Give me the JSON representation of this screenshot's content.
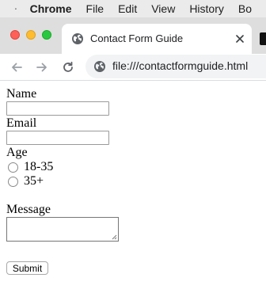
{
  "menubar": {
    "app_name": "Chrome",
    "items": [
      "File",
      "Edit",
      "View",
      "History",
      "Bo"
    ]
  },
  "tab": {
    "title": "Contact Form Guide"
  },
  "omnibox": {
    "url": "file:///contactformguide.html"
  },
  "form": {
    "name_label": "Name",
    "email_label": "Email",
    "age_label": "Age",
    "age_options": [
      "18-35",
      "35+"
    ],
    "message_label": "Message",
    "submit_label": "Submit"
  },
  "colors": {
    "traffic_red": "#fe5f57",
    "traffic_yellow": "#febc2e",
    "traffic_green": "#28c840",
    "tabstrip_bg": "#dedede",
    "omnibox_bg": "#f1f3f4"
  }
}
